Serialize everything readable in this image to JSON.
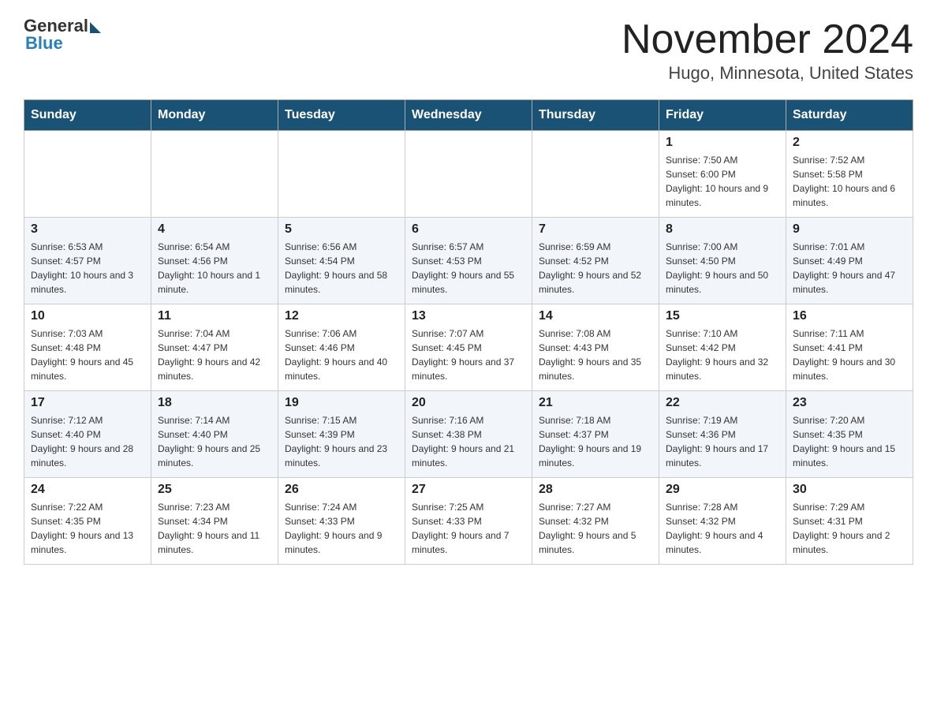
{
  "header": {
    "logo_general": "General",
    "logo_blue": "Blue",
    "month_title": "November 2024",
    "location": "Hugo, Minnesota, United States"
  },
  "weekdays": [
    "Sunday",
    "Monday",
    "Tuesday",
    "Wednesday",
    "Thursday",
    "Friday",
    "Saturday"
  ],
  "weeks": [
    [
      {
        "day": "",
        "info": ""
      },
      {
        "day": "",
        "info": ""
      },
      {
        "day": "",
        "info": ""
      },
      {
        "day": "",
        "info": ""
      },
      {
        "day": "",
        "info": ""
      },
      {
        "day": "1",
        "info": "Sunrise: 7:50 AM\nSunset: 6:00 PM\nDaylight: 10 hours and 9 minutes."
      },
      {
        "day": "2",
        "info": "Sunrise: 7:52 AM\nSunset: 5:58 PM\nDaylight: 10 hours and 6 minutes."
      }
    ],
    [
      {
        "day": "3",
        "info": "Sunrise: 6:53 AM\nSunset: 4:57 PM\nDaylight: 10 hours and 3 minutes."
      },
      {
        "day": "4",
        "info": "Sunrise: 6:54 AM\nSunset: 4:56 PM\nDaylight: 10 hours and 1 minute."
      },
      {
        "day": "5",
        "info": "Sunrise: 6:56 AM\nSunset: 4:54 PM\nDaylight: 9 hours and 58 minutes."
      },
      {
        "day": "6",
        "info": "Sunrise: 6:57 AM\nSunset: 4:53 PM\nDaylight: 9 hours and 55 minutes."
      },
      {
        "day": "7",
        "info": "Sunrise: 6:59 AM\nSunset: 4:52 PM\nDaylight: 9 hours and 52 minutes."
      },
      {
        "day": "8",
        "info": "Sunrise: 7:00 AM\nSunset: 4:50 PM\nDaylight: 9 hours and 50 minutes."
      },
      {
        "day": "9",
        "info": "Sunrise: 7:01 AM\nSunset: 4:49 PM\nDaylight: 9 hours and 47 minutes."
      }
    ],
    [
      {
        "day": "10",
        "info": "Sunrise: 7:03 AM\nSunset: 4:48 PM\nDaylight: 9 hours and 45 minutes."
      },
      {
        "day": "11",
        "info": "Sunrise: 7:04 AM\nSunset: 4:47 PM\nDaylight: 9 hours and 42 minutes."
      },
      {
        "day": "12",
        "info": "Sunrise: 7:06 AM\nSunset: 4:46 PM\nDaylight: 9 hours and 40 minutes."
      },
      {
        "day": "13",
        "info": "Sunrise: 7:07 AM\nSunset: 4:45 PM\nDaylight: 9 hours and 37 minutes."
      },
      {
        "day": "14",
        "info": "Sunrise: 7:08 AM\nSunset: 4:43 PM\nDaylight: 9 hours and 35 minutes."
      },
      {
        "day": "15",
        "info": "Sunrise: 7:10 AM\nSunset: 4:42 PM\nDaylight: 9 hours and 32 minutes."
      },
      {
        "day": "16",
        "info": "Sunrise: 7:11 AM\nSunset: 4:41 PM\nDaylight: 9 hours and 30 minutes."
      }
    ],
    [
      {
        "day": "17",
        "info": "Sunrise: 7:12 AM\nSunset: 4:40 PM\nDaylight: 9 hours and 28 minutes."
      },
      {
        "day": "18",
        "info": "Sunrise: 7:14 AM\nSunset: 4:40 PM\nDaylight: 9 hours and 25 minutes."
      },
      {
        "day": "19",
        "info": "Sunrise: 7:15 AM\nSunset: 4:39 PM\nDaylight: 9 hours and 23 minutes."
      },
      {
        "day": "20",
        "info": "Sunrise: 7:16 AM\nSunset: 4:38 PM\nDaylight: 9 hours and 21 minutes."
      },
      {
        "day": "21",
        "info": "Sunrise: 7:18 AM\nSunset: 4:37 PM\nDaylight: 9 hours and 19 minutes."
      },
      {
        "day": "22",
        "info": "Sunrise: 7:19 AM\nSunset: 4:36 PM\nDaylight: 9 hours and 17 minutes."
      },
      {
        "day": "23",
        "info": "Sunrise: 7:20 AM\nSunset: 4:35 PM\nDaylight: 9 hours and 15 minutes."
      }
    ],
    [
      {
        "day": "24",
        "info": "Sunrise: 7:22 AM\nSunset: 4:35 PM\nDaylight: 9 hours and 13 minutes."
      },
      {
        "day": "25",
        "info": "Sunrise: 7:23 AM\nSunset: 4:34 PM\nDaylight: 9 hours and 11 minutes."
      },
      {
        "day": "26",
        "info": "Sunrise: 7:24 AM\nSunset: 4:33 PM\nDaylight: 9 hours and 9 minutes."
      },
      {
        "day": "27",
        "info": "Sunrise: 7:25 AM\nSunset: 4:33 PM\nDaylight: 9 hours and 7 minutes."
      },
      {
        "day": "28",
        "info": "Sunrise: 7:27 AM\nSunset: 4:32 PM\nDaylight: 9 hours and 5 minutes."
      },
      {
        "day": "29",
        "info": "Sunrise: 7:28 AM\nSunset: 4:32 PM\nDaylight: 9 hours and 4 minutes."
      },
      {
        "day": "30",
        "info": "Sunrise: 7:29 AM\nSunset: 4:31 PM\nDaylight: 9 hours and 2 minutes."
      }
    ]
  ]
}
